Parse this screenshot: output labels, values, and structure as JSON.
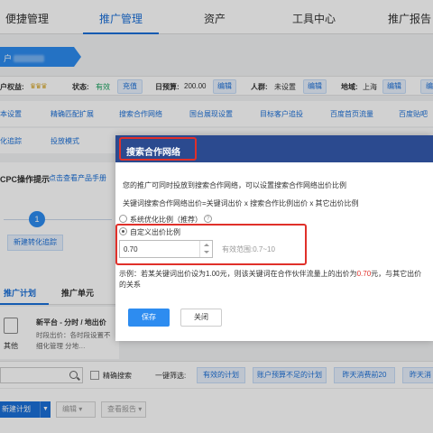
{
  "nav": {
    "items": [
      "便捷管理",
      "推广管理",
      "资产",
      "工具中心",
      "推广报告"
    ],
    "active_index": 1
  },
  "account": {
    "prefix": "户"
  },
  "info": {
    "rights_label": "户权益:",
    "status_label": "状态:",
    "status_value": "有效",
    "recharge": "充值",
    "budget_label": "日预算:",
    "budget_value": "200.00",
    "edit1": "编辑",
    "crowd_label": "人群:",
    "crowd_value": "未设置",
    "edit2": "编辑",
    "region_label": "地域:",
    "region_value": "上海",
    "edit3": "编辑",
    "edit4": "编"
  },
  "tools_row1": [
    "本设置",
    "精确匹配扩展",
    "搜索合作网络",
    "国台展现设置",
    "目标客户追投",
    "百度首页流量",
    "百度贴吧"
  ],
  "tools_row2": [
    "化追踪",
    "投放模式"
  ],
  "left_panel": {
    "title": "CPC操作提示",
    "guide_link": "点击查看产品手册",
    "step_number": "1",
    "step_button": "新建转化追踪"
  },
  "tabs": [
    "推广计划",
    "推广单元"
  ],
  "new_platform": {
    "title": "新平台 - 分时 / 地出价",
    "line1": "时段出价：各时段设置不",
    "line2": "细化管理 分地…",
    "icon_label": "其他"
  },
  "filter": {
    "precise_search": "精确搜索",
    "quick_filter": "一键筛选:",
    "chips": [
      "有效的计划",
      "账户预算不足的计划",
      "昨天消费前20",
      "昨天消"
    ]
  },
  "actions": {
    "new_plan": "新建计划",
    "edit": "编辑",
    "view_report": "查看报告"
  },
  "dialog": {
    "title": "搜索合作网络",
    "desc": "您的推广可同时投放到搜索合作网络，可以设置搜索合作网络出价比例",
    "formula": "关键词搜索合作网络出价=关键词出价 x 搜索合作比例出价 x 其它出价比例",
    "option_system": "系统优化比例（推荐）",
    "help": "?",
    "option_custom": "自定义出价比例",
    "ratio_value": "0.70",
    "valid_range": "有效范围:0.7~10",
    "example_prefix": "示例：若某关键词出价设为1.00元，则该关键词在合作伙伴流量上的出价为",
    "example_value": "0.70",
    "example_suffix": "元，与其它出价",
    "example_line2": "的关系",
    "save": "保存",
    "close": "关闭"
  },
  "colors": {
    "accent": "#1a6fd8",
    "dialog_header": "#2b4a8f",
    "highlight": "#e0302a",
    "status_green": "#19a15f"
  }
}
